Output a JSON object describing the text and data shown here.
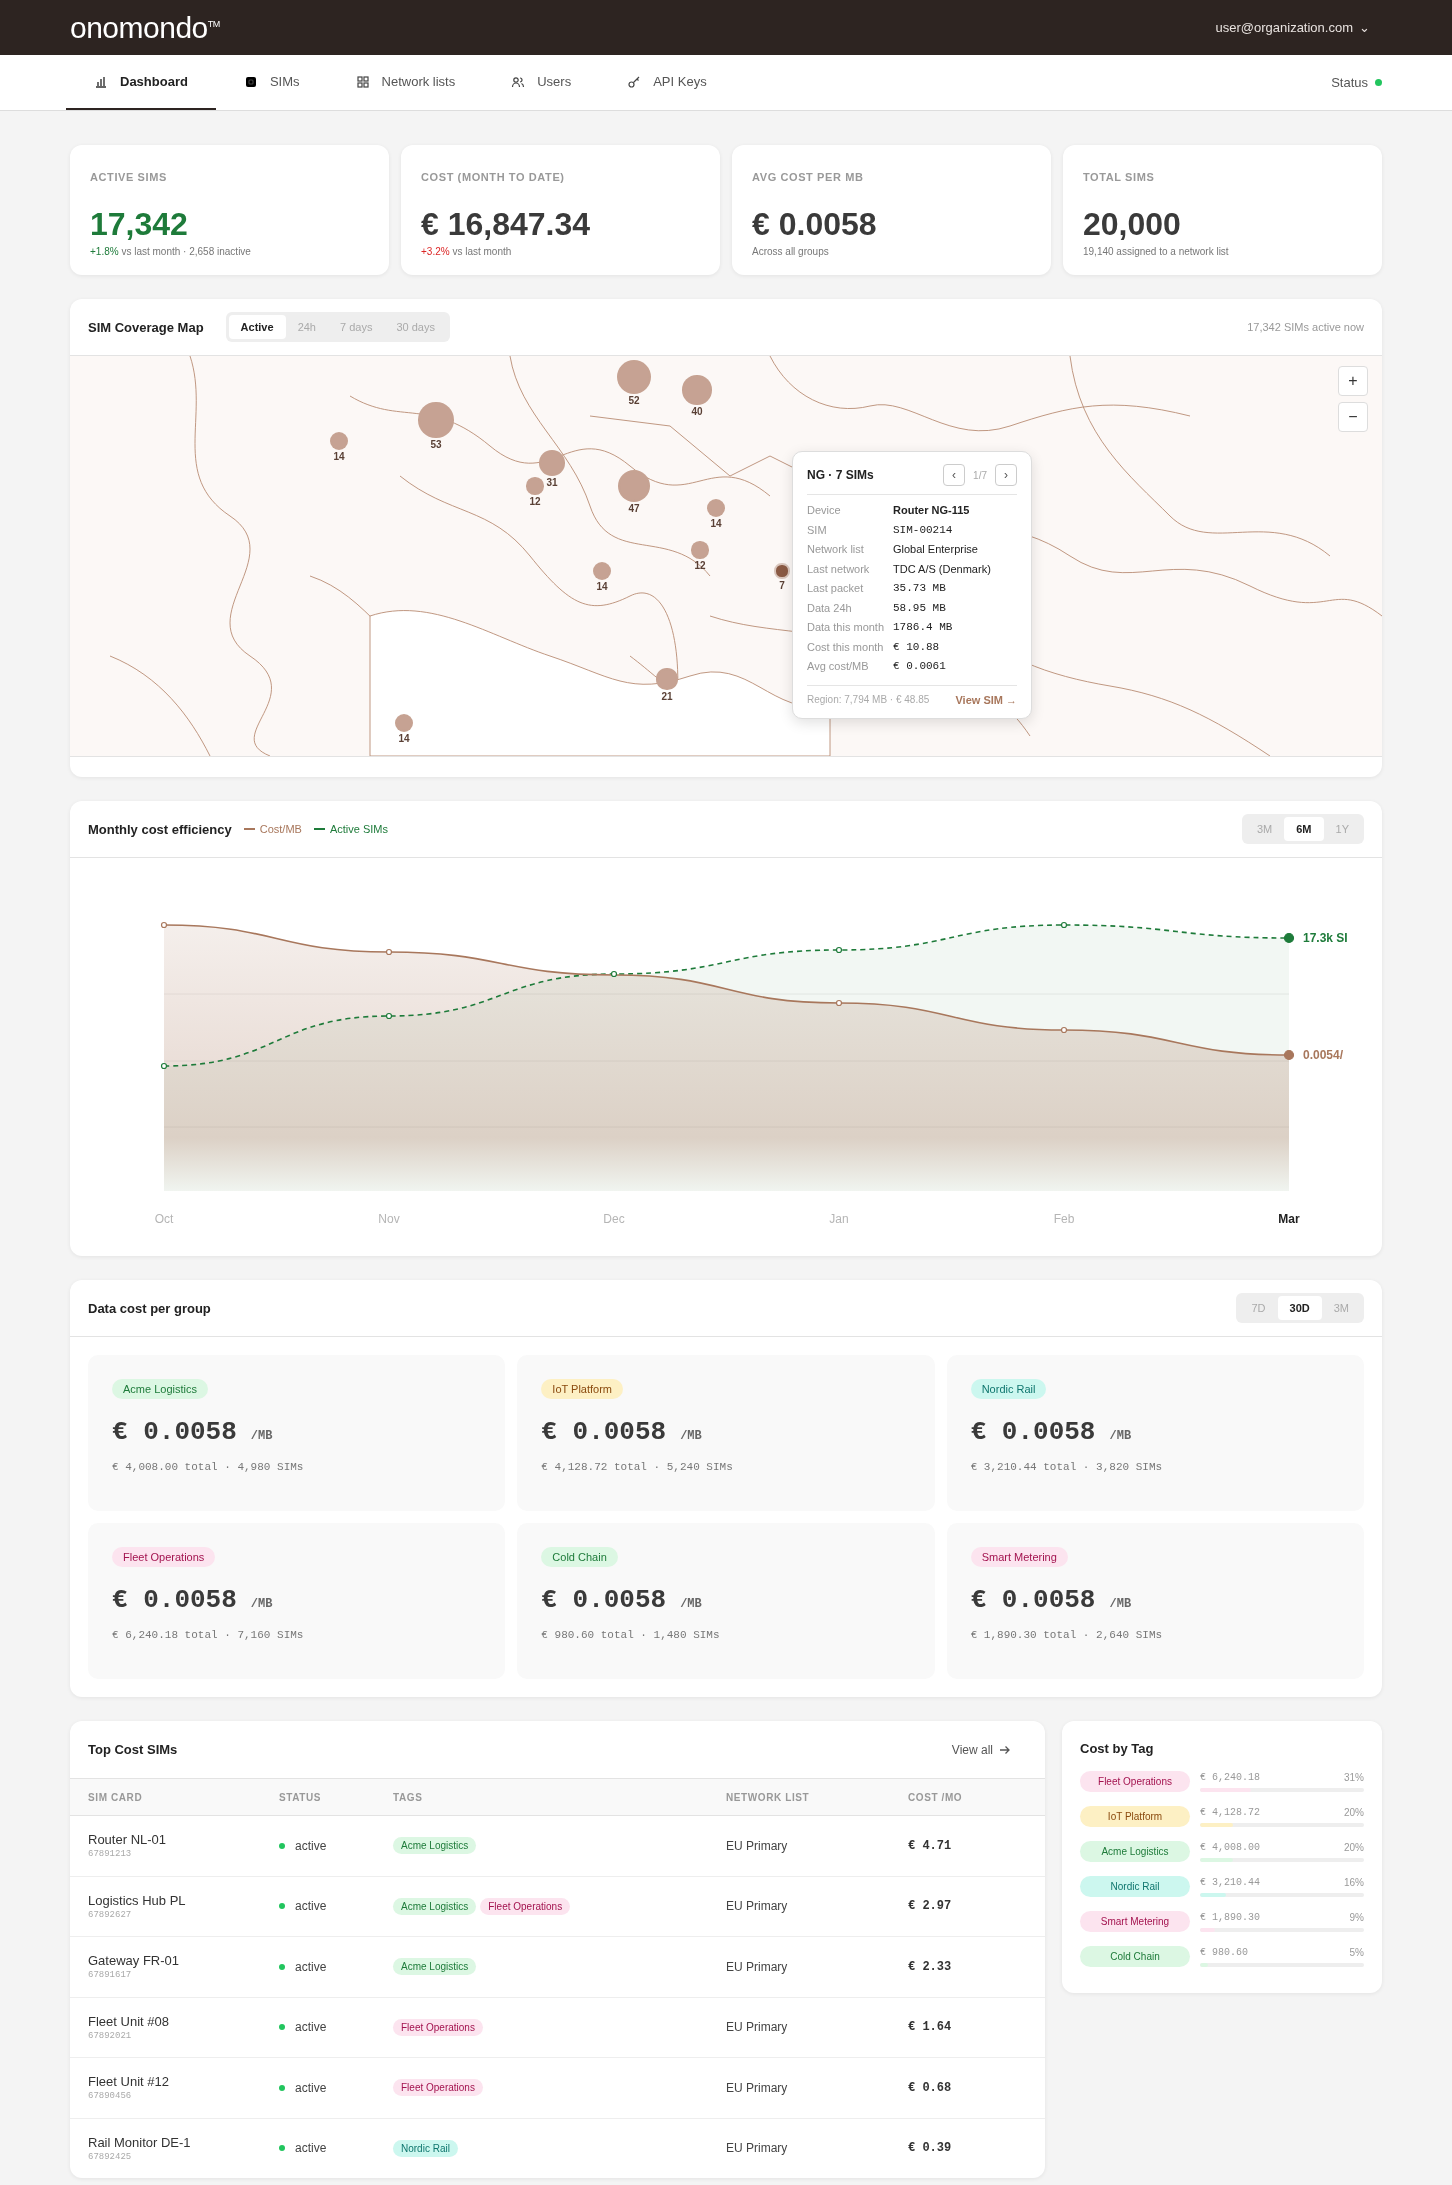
{
  "header": {
    "logo": "onomondo",
    "trademark": "TM",
    "user": "user@organization.com",
    "menu_caret": "⌄"
  },
  "nav": {
    "tabs": [
      {
        "label": "Dashboard",
        "kind": "chart",
        "selected": true
      },
      {
        "label": "SIMs",
        "kind": "sim",
        "selected": false
      },
      {
        "label": "Network lists",
        "kind": "grid",
        "selected": false
      },
      {
        "label": "Users",
        "kind": "users",
        "selected": false
      },
      {
        "label": "API Keys",
        "kind": "key",
        "selected": false
      }
    ],
    "status": {
      "label": "Status",
      "online": true
    }
  },
  "kpis": [
    {
      "label": "ACTIVE SIMS",
      "value": "17,342",
      "value_highlighted": true,
      "delta": "+1.8%",
      "delta_positive": true,
      "note": "vs last month · 2,658 inactive"
    },
    {
      "label": "COST (MONTH TO DATE)",
      "value": "€ 16,847.34",
      "value_highlighted": false,
      "delta": "+3.2%",
      "delta_positive": false,
      "note": "vs last month"
    },
    {
      "label": "AVG COST PER MB",
      "value": "€ 0.0058",
      "value_highlighted": false,
      "note": "Across all groups"
    },
    {
      "label": "TOTAL SIMS",
      "value": "20,000",
      "value_highlighted": false,
      "note": "19,140 assigned to a network list"
    }
  ],
  "map": {
    "title": "SIM Coverage Map",
    "filters": [
      {
        "label": "Active",
        "selected": true
      },
      {
        "label": "24h",
        "selected": false
      },
      {
        "label": "7 days",
        "selected": false
      },
      {
        "label": "30 days",
        "selected": false
      }
    ],
    "summary": "17,342 SIMs active now",
    "zoom_in": "+",
    "zoom_out": "−",
    "bubbles": [
      {
        "label": "14",
        "selected": false
      },
      {
        "label": "53",
        "selected": false
      },
      {
        "label": "52",
        "selected": false
      },
      {
        "label": "40",
        "selected": false
      },
      {
        "label": "31",
        "selected": false
      },
      {
        "label": "12",
        "selected": false
      },
      {
        "label": "47",
        "selected": false
      },
      {
        "label": "14",
        "selected": false
      },
      {
        "label": "12",
        "selected": false
      },
      {
        "label": "14",
        "selected": false
      },
      {
        "label": "7",
        "selected": true
      },
      {
        "label": "21",
        "selected": false
      },
      {
        "label": "14",
        "selected": false
      }
    ],
    "popup": {
      "title": "NG · 7 SIMs",
      "prev": "‹",
      "page": "1/7",
      "next": "›",
      "fields": [
        {
          "label": "Device",
          "value": "Router NG-115",
          "kind": "bold"
        },
        {
          "label": "SIM",
          "value": "SIM-00214",
          "kind": "mono"
        },
        {
          "label": "Network list",
          "value": "Global Enterprise",
          "kind": "text"
        },
        {
          "label": "Last network",
          "value": "TDC A/S (Denmark)",
          "kind": "text"
        },
        {
          "label": "Last packet",
          "value": "35.73 MB",
          "kind": "mono"
        },
        {
          "label": "Data 24h",
          "value": "58.95 MB",
          "kind": "mono"
        },
        {
          "label": "Data this month",
          "value": "1786.4 MB",
          "kind": "mono"
        },
        {
          "label": "Cost this month",
          "value": "€ 10.88",
          "kind": "mono"
        },
        {
          "label": "Avg cost/MB",
          "value": "€ 0.0061",
          "kind": "mono"
        }
      ],
      "footer": "Region: 7,794 MB · € 48.85",
      "link": "View SIM →"
    }
  },
  "chart": {
    "title": "Monthly cost efficiency",
    "series": [
      {
        "name": "Cost/MB",
        "color": "#a8775c"
      },
      {
        "name": "Active SIMs",
        "color": "#1e7b3a"
      }
    ],
    "end_labels": [
      {
        "label": "17.3k SI",
        "color": "#1e7b3a"
      },
      {
        "label": "0.0054/",
        "color": "#a8775c"
      }
    ],
    "ranges": [
      {
        "label": "3M",
        "selected": false
      },
      {
        "label": "6M",
        "selected": true
      },
      {
        "label": "1Y",
        "selected": false
      }
    ],
    "x_labels": [
      {
        "label": "Oct",
        "highlighted": false
      },
      {
        "label": "Nov",
        "highlighted": false
      },
      {
        "label": "Dec",
        "highlighted": false
      },
      {
        "label": "Jan",
        "highlighted": false
      },
      {
        "label": "Feb",
        "highlighted": false
      },
      {
        "label": "Mar",
        "highlighted": true
      }
    ]
  },
  "groups": {
    "title": "Data cost per group",
    "ranges": [
      {
        "label": "7D",
        "selected": false
      },
      {
        "label": "30D",
        "selected": true
      },
      {
        "label": "3M",
        "selected": false
      }
    ],
    "items": [
      {
        "tag": {
          "label": "Acme Logistics",
          "color": "#dcf7e3"
        },
        "price": "€ 0.0058",
        "unit": "/MB",
        "detail": "€ 4,008.00 total · 4,980 SIMs"
      },
      {
        "tag": {
          "label": "IoT Platform",
          "color": "#fdf0c4"
        },
        "price": "€ 0.0058",
        "unit": "/MB",
        "detail": "€ 4,128.72 total · 5,240 SIMs"
      },
      {
        "tag": {
          "label": "Nordic Rail",
          "color": "#ccf7ef"
        },
        "price": "€ 0.0058",
        "unit": "/MB",
        "detail": "€ 3,210.44 total · 3,820 SIMs"
      },
      {
        "tag": {
          "label": "Fleet Operations",
          "color": "#fce4ef"
        },
        "price": "€ 0.0058",
        "unit": "/MB",
        "detail": "€ 6,240.18 total · 7,160 SIMs"
      },
      {
        "tag": {
          "label": "Cold Chain",
          "color": "#dcf7e3"
        },
        "price": "€ 0.0058",
        "unit": "/MB",
        "detail": "€ 980.60 total · 1,480 SIMs"
      },
      {
        "tag": {
          "label": "Smart Metering",
          "color": "#fce4ef"
        },
        "price": "€ 0.0058",
        "unit": "/MB",
        "detail": "€ 1,890.30 total · 2,640 SIMs"
      }
    ]
  },
  "table": {
    "title": "Top Cost SIMs",
    "view_all": "View all",
    "columns": [
      "SIM CARD",
      "STATUS",
      "TAGS",
      "NETWORK LIST",
      "COST /MO"
    ],
    "rows": [
      {
        "name": "Router NL-01",
        "id": "67891213",
        "status": "active",
        "tags": [
          {
            "label": "Acme Logistics",
            "color": "#dcf7e3"
          }
        ],
        "network": "EU Primary",
        "cost": "€ 4.71"
      },
      {
        "name": "Logistics Hub PL",
        "id": "67892627",
        "status": "active",
        "tags": [
          {
            "label": "Acme Logistics",
            "color": "#dcf7e3"
          },
          {
            "label": "Fleet Operations",
            "color": "#fce4ef"
          }
        ],
        "network": "EU Primary",
        "cost": "€ 2.97"
      },
      {
        "name": "Gateway FR-01",
        "id": "67891617",
        "status": "active",
        "tags": [
          {
            "label": "Acme Logistics",
            "color": "#dcf7e3"
          }
        ],
        "network": "EU Primary",
        "cost": "€ 2.33"
      },
      {
        "name": "Fleet Unit #08",
        "id": "67892021",
        "status": "active",
        "tags": [
          {
            "label": "Fleet Operations",
            "color": "#fce4ef"
          }
        ],
        "network": "EU Primary",
        "cost": "€ 1.64"
      },
      {
        "name": "Fleet Unit #12",
        "id": "67890456",
        "status": "active",
        "tags": [
          {
            "label": "Fleet Operations",
            "color": "#fce4ef"
          }
        ],
        "network": "EU Primary",
        "cost": "€ 0.68"
      },
      {
        "name": "Rail Monitor DE-1",
        "id": "67892425",
        "status": "active",
        "tags": [
          {
            "label": "Nordic Rail",
            "color": "#ccf7ef"
          }
        ],
        "network": "EU Primary",
        "cost": "€ 0.39"
      }
    ]
  },
  "cost_by_tag": {
    "title": "Cost by Tag",
    "items": [
      {
        "label": "Fleet Operations",
        "color": "#fce4ef",
        "amount": "€ 6,240.18",
        "share": "31%",
        "level": 0.31
      },
      {
        "label": "IoT Platform",
        "color": "#fdf0c4",
        "amount": "€ 4,128.72",
        "share": "20%",
        "level": 0.2
      },
      {
        "label": "Acme Logistics",
        "color": "#dcf7e3",
        "amount": "€ 4,008.00",
        "share": "20%",
        "level": 0.2
      },
      {
        "label": "Nordic Rail",
        "color": "#ccf7ef",
        "amount": "€ 3,210.44",
        "share": "16%",
        "level": 0.16
      },
      {
        "label": "Smart Metering",
        "color": "#fce4ef",
        "amount": "€ 1,890.30",
        "share": "9%",
        "level": 0.09
      },
      {
        "label": "Cold Chain",
        "color": "#dcf7e3",
        "amount": "€ 980.60",
        "share": "5%",
        "level": 0.05
      }
    ]
  }
}
